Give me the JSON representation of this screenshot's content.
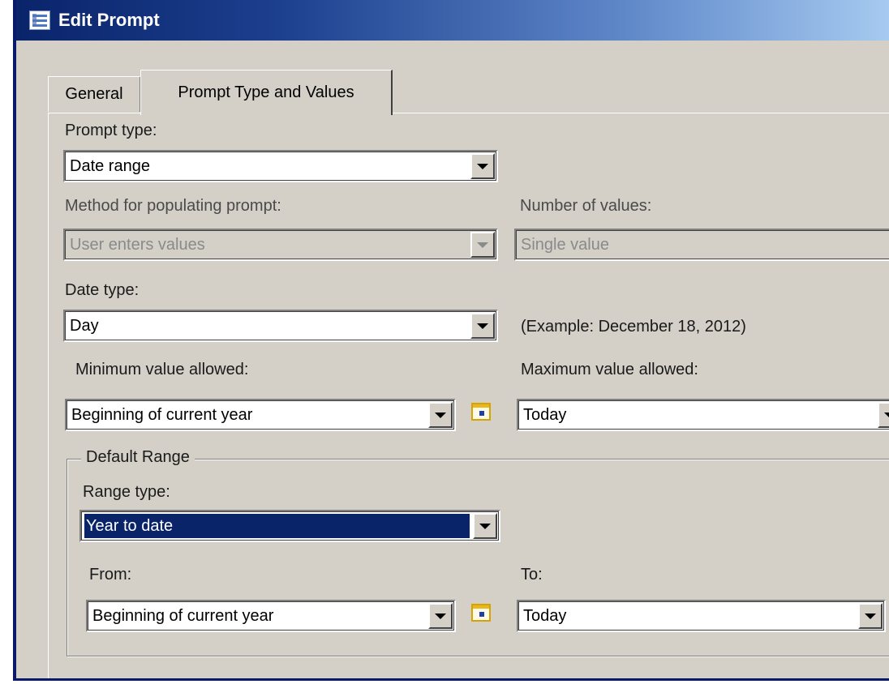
{
  "window": {
    "title": "Edit Prompt",
    "title_icon": "list-form-icon"
  },
  "tabs": [
    {
      "label": "General",
      "active": false
    },
    {
      "label": "Prompt Type and Values",
      "active": true
    }
  ],
  "form": {
    "prompt_type": {
      "label": "Prompt type:",
      "value": "Date range"
    },
    "method": {
      "label": "Method for populating prompt:",
      "value": "User enters values",
      "disabled": true
    },
    "number_of_values": {
      "label": "Number of values:",
      "value": "Single value",
      "disabled": true
    },
    "date_type": {
      "label": "Date type:",
      "value": "Day",
      "example": "(Example: December 18, 2012)"
    },
    "min_value": {
      "label": "Minimum value allowed:",
      "value": "Beginning of current year"
    },
    "max_value": {
      "label": "Maximum value allowed:",
      "value": "Today"
    }
  },
  "default_range": {
    "legend": "Default Range",
    "range_type": {
      "label": "Range type:",
      "value": "Year to date"
    },
    "from": {
      "label": "From:",
      "value": "Beginning of current year"
    },
    "to": {
      "label": "To:",
      "value": "Today"
    }
  },
  "icons": {
    "dropdown": "chevron-down-icon",
    "calendar": "calendar-icon"
  },
  "colors": {
    "titlebar": "#0a246a",
    "selection": "#0a246a",
    "face": "#d4d0c8"
  }
}
